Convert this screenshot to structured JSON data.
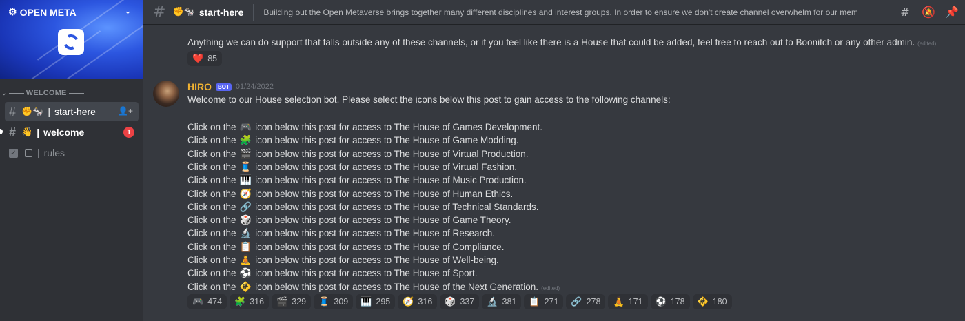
{
  "server": {
    "name": "OPEN META",
    "category": "WELCOME"
  },
  "channels": [
    {
      "name": "start-here",
      "emoji": "✊🐄",
      "active": true
    },
    {
      "name": "welcome",
      "emoji": "👋",
      "unread_count": "1"
    },
    {
      "name": "rules",
      "emoji": "☐"
    }
  ],
  "header": {
    "channel_emoji": "✊🐄",
    "channel_name": "start-here",
    "topic": "Building out the Open Metaverse brings together many different disciplines and interest groups. In order to ensure we don't create channel overwhelm for our member..."
  },
  "messages": {
    "prev_text": "Anything we can do support that falls outside any of these channels, or if you feel like there is a House that could be added, feel free to reach out to Boonitch or any other admin.",
    "prev_edited": "(edited)",
    "prev_reaction": {
      "emoji": "❤️",
      "count": "85"
    },
    "author": "HIRO",
    "bot_tag": "BOT",
    "timestamp": "01/24/2022",
    "intro": "Welcome to our House selection bot. Please select the icons below this post to gain access to the following channels:",
    "edited": "(edited)"
  },
  "houses": [
    {
      "emoji": "🎮",
      "prefix": "Click on the",
      "text": "icon below this post for access to The House of Games Development."
    },
    {
      "emoji": "🧩",
      "prefix": "Click on the",
      "text": "icon below this post for access to The House of Game Modding."
    },
    {
      "emoji": "🎬",
      "prefix": "Click on the",
      "text": "icon below this post for access to The House of Virtual Production."
    },
    {
      "emoji": "🧵",
      "prefix": "Click on the",
      "text": "icon below this post for access to The House of Virtual Fashion."
    },
    {
      "emoji": "🎹",
      "prefix": "Click on the",
      "text": "icon below this post for access to The House of Music Production."
    },
    {
      "emoji": "🧭",
      "prefix": "Click on the",
      "text": "icon below this post for access to The House of Human Ethics."
    },
    {
      "emoji": "🔗",
      "prefix": "Click on the",
      "text": "icon below this post for access to The House of Technical Standards."
    },
    {
      "emoji": "🎲",
      "prefix": "Click on the",
      "text": "icon below this post for access to The House of Game Theory."
    },
    {
      "emoji": "🔬",
      "prefix": "Click on the",
      "text": "icon below this post for access to The House of Research."
    },
    {
      "emoji": "📋",
      "prefix": "Click on the",
      "text": "icon below this post for access to The House of Compliance."
    },
    {
      "emoji": "🧘",
      "prefix": "Click on the",
      "text": "icon below this post for access to The House of Well-being."
    },
    {
      "emoji": "⚽",
      "prefix": "Click on the",
      "text": "icon below this post for access to The House of Sport."
    },
    {
      "emoji": "🚸",
      "prefix": "Click on the",
      "text": "icon below this post for access to The House of the Next Generation."
    }
  ],
  "reactions": [
    {
      "emoji": "🎮",
      "count": "474"
    },
    {
      "emoji": "🧩",
      "count": "316"
    },
    {
      "emoji": "🎬",
      "count": "329"
    },
    {
      "emoji": "🧵",
      "count": "309"
    },
    {
      "emoji": "🎹",
      "count": "295"
    },
    {
      "emoji": "🧭",
      "count": "316"
    },
    {
      "emoji": "🎲",
      "count": "337"
    },
    {
      "emoji": "🔬",
      "count": "381"
    },
    {
      "emoji": "📋",
      "count": "271"
    },
    {
      "emoji": "🔗",
      "count": "278"
    },
    {
      "emoji": "🧘",
      "count": "171"
    },
    {
      "emoji": "⚽",
      "count": "178"
    },
    {
      "emoji": "🚸",
      "count": "180"
    }
  ]
}
